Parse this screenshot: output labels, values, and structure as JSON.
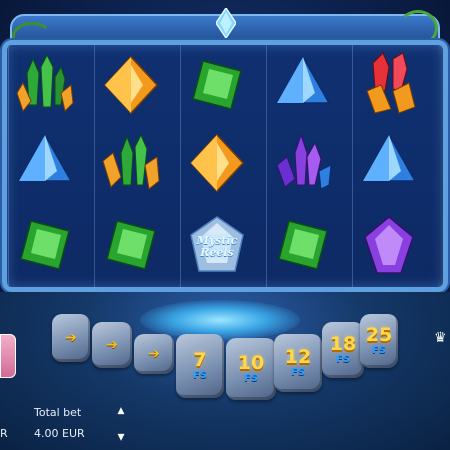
{
  "reels": [
    [
      "green-crystal-cluster",
      "blue-diamond",
      "green-gem"
    ],
    [
      "orange-diamond",
      "orange-green-crystal-cluster",
      "green-gem"
    ],
    [
      "green-gem",
      "orange-diamond",
      "mystic-reels-logo"
    ],
    [
      "blue-diamond",
      "purple-crystal-cluster",
      "green-gem"
    ],
    [
      "red-orange-crystal-cluster",
      "blue-diamond",
      "purple-gem"
    ]
  ],
  "logo": {
    "line1": "Mystic",
    "line2": "Reels"
  },
  "free_spins": {
    "suffix": "FS",
    "steps": [
      "7",
      "10",
      "12",
      "18",
      "25"
    ]
  },
  "bet": {
    "label": "Total bet",
    "value": "4.00 EUR",
    "up_icon": "triangle-up-icon",
    "down_icon": "triangle-down-icon"
  },
  "left_clip_text": "R",
  "colors": {
    "frame": "#5fa0e0",
    "background": "#0c2350",
    "fs_number": "#ffd84a",
    "fs_label": "#2ba0ff",
    "arrow": "#f4c021"
  }
}
